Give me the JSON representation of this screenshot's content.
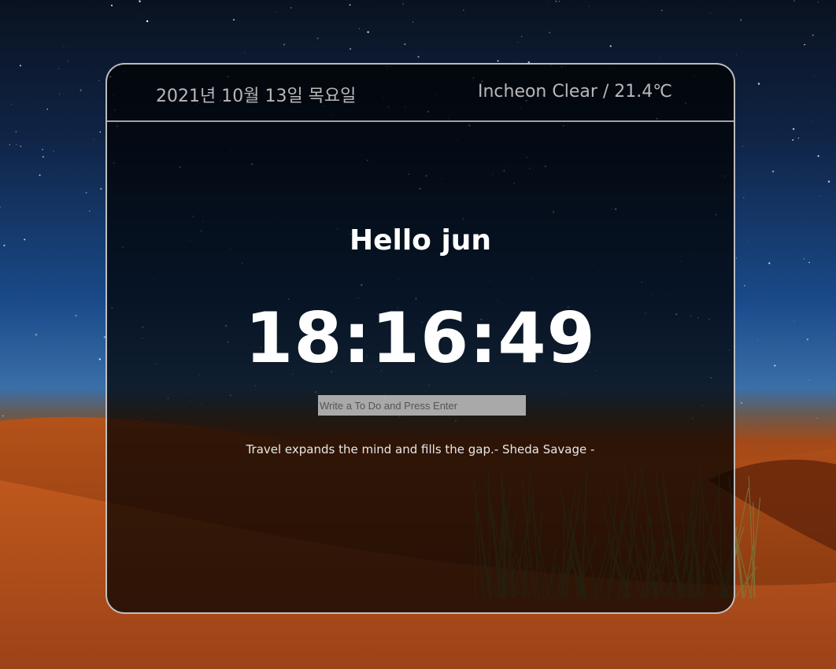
{
  "header": {
    "date": "2021년 10월 13일 목요일",
    "weather": "Incheon Clear / 21.4℃"
  },
  "greeting": "Hello jun",
  "clock": "18:16:49",
  "todo": {
    "placeholder": "Write a To Do and Press Enter",
    "value": ""
  },
  "quote": {
    "text": "Travel expands the mind and fills the gap.",
    "author": "- Sheda Savage -"
  },
  "colors": {
    "card_border": "#dcdcdc",
    "header_text": "#b8b8b8",
    "main_text": "#ffffff",
    "input_bg": "#a9a9a9"
  }
}
